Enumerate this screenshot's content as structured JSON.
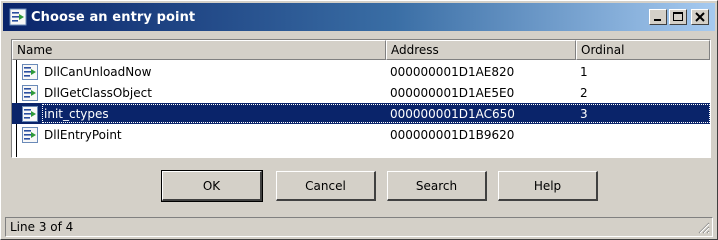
{
  "window": {
    "title": "Choose an entry point",
    "icon": "entry-point-icon"
  },
  "columns": {
    "name": "Name",
    "address": "Address",
    "ordinal": "Ordinal"
  },
  "rows": [
    {
      "name": "DllCanUnloadNow",
      "address": "000000001D1AE820",
      "ordinal": "1",
      "icon": "entry-point-icon"
    },
    {
      "name": "DllGetClassObject",
      "address": "000000001D1AE5E0",
      "ordinal": "2",
      "icon": "entry-point-icon"
    },
    {
      "name": "init_ctypes",
      "address": "000000001D1AC650",
      "ordinal": "3",
      "icon": "entry-point-icon"
    },
    {
      "name": "DllEntryPoint",
      "address": "000000001D1B9620",
      "ordinal": "",
      "icon": "entry-point-icon"
    }
  ],
  "selected_row": 2,
  "buttons": {
    "ok": "OK",
    "cancel": "Cancel",
    "search": "Search",
    "help": "Help"
  },
  "status": {
    "text": "Line 3 of 4"
  },
  "colors": {
    "title_start": "#0a246a",
    "title_end": "#a6caf0",
    "selection": "#0a246a",
    "face": "#d4d0c8"
  }
}
